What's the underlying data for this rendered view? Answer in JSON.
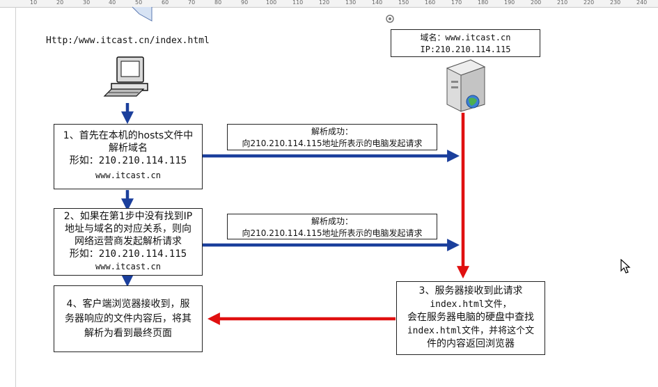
{
  "ruler": {
    "ticks": [
      "10",
      "20",
      "30",
      "40",
      "50",
      "60",
      "70",
      "80",
      "90",
      "100",
      "110",
      "120",
      "130",
      "140",
      "150",
      "160",
      "170",
      "180",
      "190",
      "200",
      "210",
      "220",
      "230",
      "240"
    ]
  },
  "diagram": {
    "url_label": "Http:/www.itcast.cn/index.html",
    "server_info": {
      "line1": "域名：www.itcast.cn",
      "line2": "IP:210.210.114.115"
    },
    "step1": {
      "line1": "1、首先在本机的hosts文件中",
      "line2": "解析域名",
      "line3": "形如：210.210.114.115",
      "line4": "www.itcast.cn"
    },
    "step2": {
      "line1": "2、如果在第1步中没有找到IP",
      "line2": "地址与域名的对应关系，则向",
      "line3": "网络运营商发起解析请求",
      "line4": "形如：210.210.114.115",
      "line5": "www.itcast.cn"
    },
    "step3": {
      "line1": "3、服务器接收到此请求",
      "line2": "index.html文件，",
      "line3": "会在服务器电脑的硬盘中查找",
      "line4": "index.html文件，并将这个文",
      "line5": "件的内容返回浏览器"
    },
    "step4": {
      "line1": "4、客户端浏览器接收到，服",
      "line2": "务器响应的文件内容后，将其",
      "line3": "解析为看到最终页面"
    },
    "msg1": {
      "line1": "解析成功：",
      "line2": "向210.210.114.115地址所表示的电脑发起请求"
    },
    "msg2": {
      "line1": "解析成功：",
      "line2": "向210.210.114.115地址所表示的电脑发起请求"
    }
  },
  "colors": {
    "blue_arrow": "#1b3f9c",
    "red_arrow": "#e01010"
  }
}
